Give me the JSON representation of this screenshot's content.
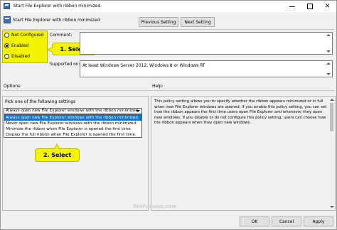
{
  "window": {
    "title": "Start File Explorer with ribbon minimized"
  },
  "header": {
    "title": "Start File Explorer with ribbon minimized",
    "prev_label": "Previous Setting",
    "next_label": "Next Setting"
  },
  "state": {
    "options": [
      {
        "label": "Not Configured",
        "checked": false
      },
      {
        "label": "Enabled",
        "checked": true
      },
      {
        "label": "Disabled",
        "checked": false
      }
    ]
  },
  "callouts": {
    "step1": "1. Select",
    "step2": "2. Select"
  },
  "comment": {
    "label": "Comment:",
    "value": ""
  },
  "supported": {
    "label": "Supported on:",
    "value": "At least Windows Server 2012, Windows 8 or Windows RT"
  },
  "options_section": {
    "label": "Options:",
    "pick_label": "Pick one of the following settings",
    "selected_value": "Always open new File Explorer windows with the ribbon minimized.",
    "items": [
      "Always open new File Explorer windows with the ribbon minimized.",
      "Never open new File Explorer windows with the ribbon minimized.",
      "Minimize the ribbon when File Explorer is opened the first time.",
      "Display the full ribbon when File Explorer is opened the first time."
    ]
  },
  "help_section": {
    "label": "Help:",
    "text": "This policy setting allows you to specify whether the ribbon appears minimized or in full when new File Explorer windows are opened. If you enable this policy setting, you can set how the ribbon appears the first time users open File Explorer and whenever they open new windows. If you disable or do not configure this policy setting, users can choose how the ribbon appears when they open new windows."
  },
  "footer": {
    "ok_label": "OK",
    "cancel_label": "Cancel",
    "apply_label": "Apply"
  },
  "watermark": "TenForums.com",
  "colors": {
    "highlight_yellow": "#f4f400",
    "selection_blue": "#0078d7"
  }
}
